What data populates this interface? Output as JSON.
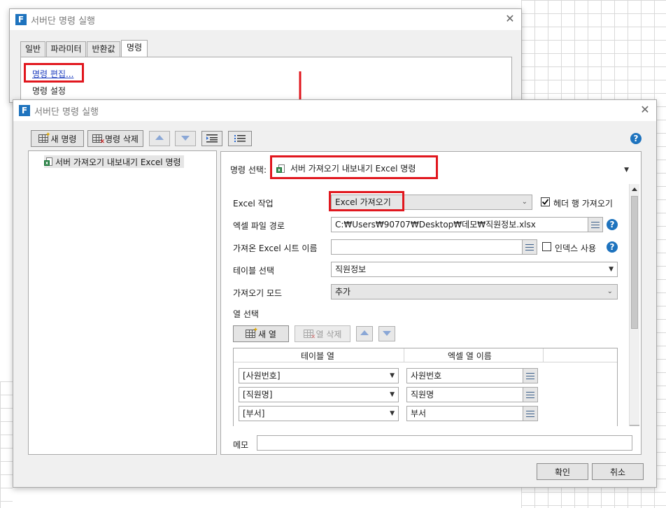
{
  "back_dialog": {
    "title": "서버단 명령 실행",
    "tabs": [
      "일반",
      "파라미터",
      "반환값",
      "명령"
    ],
    "edit_link": "명령 편집...",
    "settings_label": "명령 설정"
  },
  "dialog": {
    "title": "서버단 명령 실행",
    "toolbar": {
      "new_label": "새 명령",
      "delete_label": "명령 삭제"
    },
    "tree_item": "서버 가져오기 내보내기 Excel 명령",
    "command_select_label": "명령 선택:",
    "command_select_value": "서버 가져오기 내보내기 Excel 명령",
    "excel_op_label": "Excel 작업",
    "excel_op_value": "Excel 가져오기",
    "header_row_label": "헤더 행 가져오기",
    "header_row_checked": true,
    "file_path_label": "엑셀 파일 경로",
    "file_path_value": "C:₩Users₩90707₩Desktop₩데모₩직원정보.xlsx",
    "sheet_name_label": "가져온 Excel 시트 이름",
    "sheet_name_value": "",
    "index_label": "인덱스 사용",
    "index_checked": false,
    "table_select_label": "테이블 선택",
    "table_select_value": "직원정보",
    "import_mode_label": "가져오기 모드",
    "import_mode_value": "추가",
    "columns_label": "열 선택",
    "new_column_label": "새 열",
    "delete_column_label": "열 삭제",
    "grid_headers": [
      "테이블 열",
      "엑셀 열 이름"
    ],
    "grid_rows": [
      {
        "table_col": "[사원번호]",
        "excel_col": "사원번호"
      },
      {
        "table_col": "[직원명]",
        "excel_col": "직원명"
      },
      {
        "table_col": "[부서]",
        "excel_col": "부서"
      }
    ],
    "memo_label": "메모",
    "memo_value": "",
    "ok_label": "확인",
    "cancel_label": "취소"
  },
  "colors": {
    "highlight": "#e1171e",
    "accent": "#1e73be",
    "link": "#1f3fbf"
  }
}
